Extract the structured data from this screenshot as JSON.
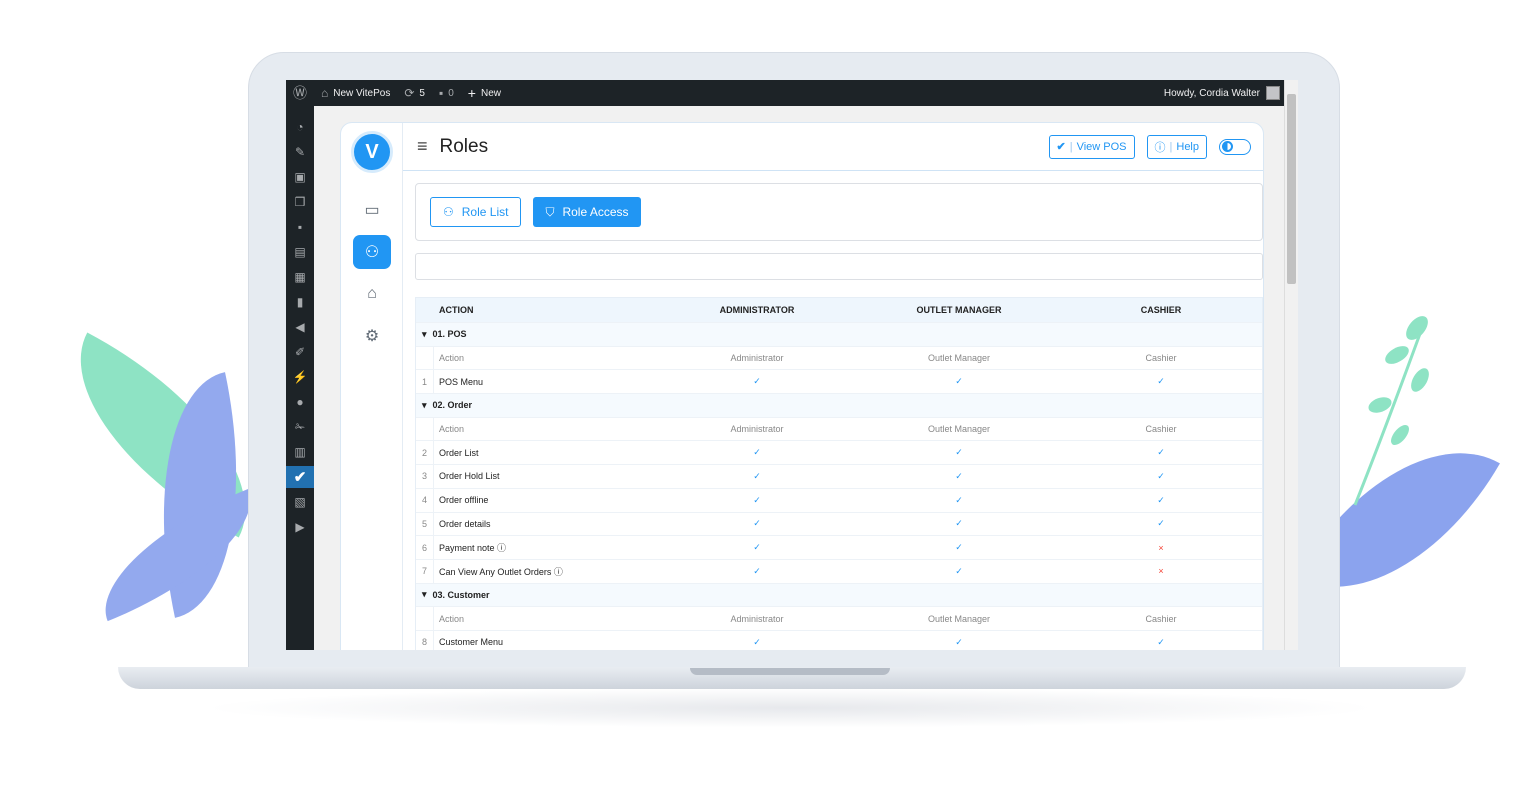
{
  "adminbar": {
    "site_name": "New VitePos",
    "updates_count": "5",
    "comments_count": "0",
    "new_label": "New",
    "greeting": "Howdy, Cordia Walter"
  },
  "app": {
    "logo_letter": "V",
    "page_title": "Roles",
    "view_pos_label": "View POS",
    "help_label": "Help",
    "tabs": {
      "role_list": "Role List",
      "role_access": "Role Access"
    }
  },
  "icons": {
    "dashboard": "dashboard-icon",
    "pin": "pin-icon",
    "media": "media-icon",
    "pages": "pages-icon",
    "comments": "comments-icon",
    "woo": "woo-icon",
    "products": "products-icon",
    "analytics": "analytics-icon",
    "marketing": "marketing-icon",
    "appearance": "appearance-icon",
    "plugins": "plugins-icon",
    "users": "users-icon",
    "tools": "tools-icon",
    "settings": "settings-icon",
    "vitepos": "vitepos-icon",
    "translate": "translate-icon",
    "play": "play-icon"
  },
  "colors": {
    "accent": "#2196f3",
    "denied": "#f44336",
    "wp_dark": "#1d2327"
  },
  "table": {
    "headers": [
      "ACTION",
      "ADMINISTRATOR",
      "OUTLET MANAGER",
      "CASHIER"
    ],
    "subheaders": [
      "Action",
      "Administrator",
      "Outlet Manager",
      "Cashier"
    ],
    "groups": [
      {
        "label": "01. POS",
        "rows": [
          {
            "num": "1",
            "action": "POS Menu",
            "admin": "✓",
            "manager": "✓",
            "cashier": "✓"
          }
        ]
      },
      {
        "label": "02. Order",
        "rows": [
          {
            "num": "2",
            "action": "Order List",
            "admin": "✓",
            "manager": "✓",
            "cashier": "✓"
          },
          {
            "num": "3",
            "action": "Order Hold List",
            "admin": "✓",
            "manager": "✓",
            "cashier": "✓"
          },
          {
            "num": "4",
            "action": "Order offline",
            "admin": "✓",
            "manager": "✓",
            "cashier": "✓"
          },
          {
            "num": "5",
            "action": "Order details",
            "admin": "✓",
            "manager": "✓",
            "cashier": "✓"
          },
          {
            "num": "6",
            "action": "Payment note ⓘ",
            "admin": "✓",
            "manager": "✓",
            "cashier": "×"
          },
          {
            "num": "7",
            "action": "Can View Any Outlet Orders ⓘ",
            "admin": "✓",
            "manager": "✓",
            "cashier": "×"
          }
        ]
      },
      {
        "label": "03. Customer",
        "rows": [
          {
            "num": "8",
            "action": "Customer Menu",
            "admin": "✓",
            "manager": "✓",
            "cashier": "✓"
          }
        ]
      }
    ]
  }
}
